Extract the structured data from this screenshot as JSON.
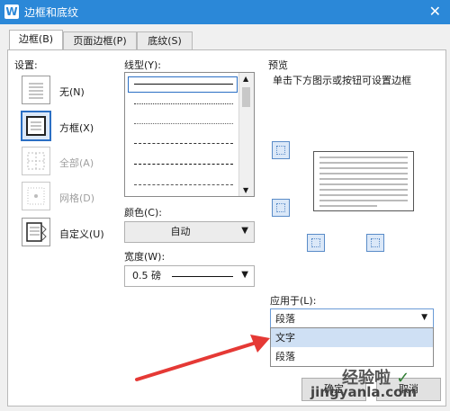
{
  "window": {
    "title": "边框和底纹",
    "app_icon": "W"
  },
  "tabs": [
    {
      "label": "边框(B)",
      "active": true
    },
    {
      "label": "页面边框(P)",
      "active": false
    },
    {
      "label": "底纹(S)",
      "active": false
    }
  ],
  "settings": {
    "heading": "设置:",
    "options": [
      {
        "label": "无(N)",
        "selected": false,
        "disabled": false
      },
      {
        "label": "方框(X)",
        "selected": true,
        "disabled": false
      },
      {
        "label": "全部(A)",
        "selected": false,
        "disabled": true
      },
      {
        "label": "网格(D)",
        "selected": false,
        "disabled": true
      },
      {
        "label": "自定义(U)",
        "selected": false,
        "disabled": false
      }
    ]
  },
  "line_style": {
    "label": "线型(Y):",
    "selected_index": 0,
    "styles": [
      "solid",
      "dotted",
      "dotted-fine",
      "dashed",
      "dash-dot",
      "dash-dot-dot"
    ]
  },
  "color": {
    "label": "颜色(C):",
    "value": "自动"
  },
  "width": {
    "label": "宽度(W):",
    "value": "0.5 磅"
  },
  "preview": {
    "heading": "预览",
    "hint": "单击下方图示或按钮可设置边框"
  },
  "apply_to": {
    "label": "应用于(L):",
    "value": "段落",
    "options": [
      "文字",
      "段落"
    ],
    "highlighted_index": 0
  },
  "buttons": {
    "ok": "确定",
    "cancel": "取消"
  },
  "watermark": {
    "line1": "经验啦",
    "line2": "jingyanla.com",
    "check": "✓"
  },
  "colors": {
    "titlebar": "#2b88d8",
    "arrow": "#e53935",
    "accent": "#2b6fc4"
  }
}
